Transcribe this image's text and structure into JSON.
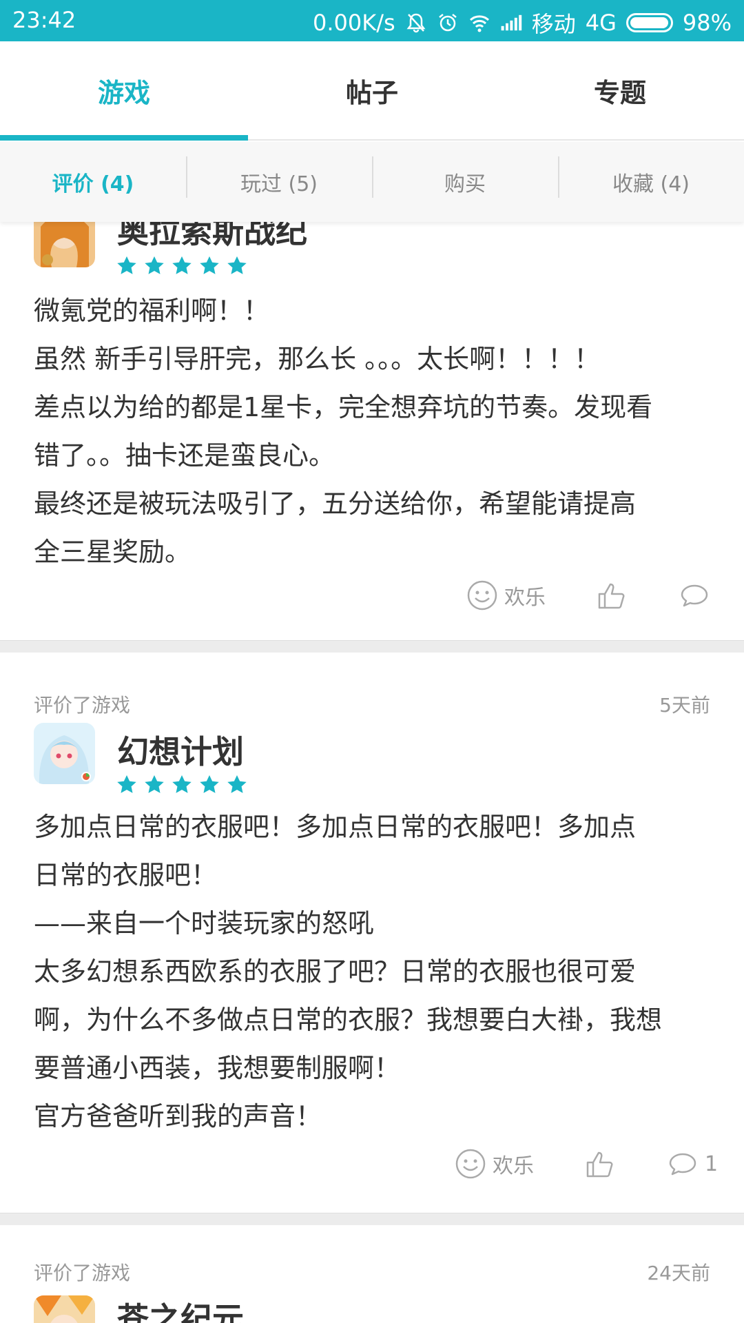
{
  "status_bar": {
    "time": "23:42",
    "network_speed": "0.00K/s",
    "carrier": "移动",
    "network_type": "4G",
    "battery": "98%"
  },
  "tabs": [
    {
      "label": "游戏",
      "active": true
    },
    {
      "label": "帖子",
      "active": false
    },
    {
      "label": "专题",
      "active": false
    }
  ],
  "subtabs": [
    {
      "label": "评价 (4)",
      "active": true
    },
    {
      "label": "玩过 (5)",
      "active": false
    },
    {
      "label": "购买",
      "active": false
    },
    {
      "label": "收藏 (4)",
      "active": false
    }
  ],
  "colors": {
    "accent": "#1ab5c6",
    "text": "#333333",
    "muted": "#999999"
  },
  "reviews": [
    {
      "game_title": "奥拉索斯战纪",
      "rating": 5,
      "lines": [
        "微氪党的福利啊！！",
        "虽然 新手引导肝完，那么长 。。。太长啊！！！！",
        "差点以为给的都是1星卡，完全想弃坑的节奏。发现看",
        "错了。。抽卡还是蛮良心。",
        "最终还是被玩法吸引了，五分送给你，希望能请提高",
        "全三星奖励。"
      ],
      "mood_label": "欢乐",
      "comment_count": ""
    },
    {
      "meta_label": "评价了游戏",
      "time": "5天前",
      "game_title": "幻想计划",
      "rating": 5,
      "lines": [
        "多加点日常的衣服吧！多加点日常的衣服吧！多加点",
        "日常的衣服吧！",
        "——来自一个时装玩家的怒吼",
        "太多幻想系西欧系的衣服了吧？日常的衣服也很可爱",
        "啊，为什么不多做点日常的衣服？我想要白大褂，我想",
        "要普通小西装，我想要制服啊！",
        "官方爸爸听到我的声音！"
      ],
      "mood_label": "欢乐",
      "comment_count": "1"
    },
    {
      "meta_label": "评价了游戏",
      "time": "24天前",
      "game_title": "苍之纪元"
    }
  ]
}
